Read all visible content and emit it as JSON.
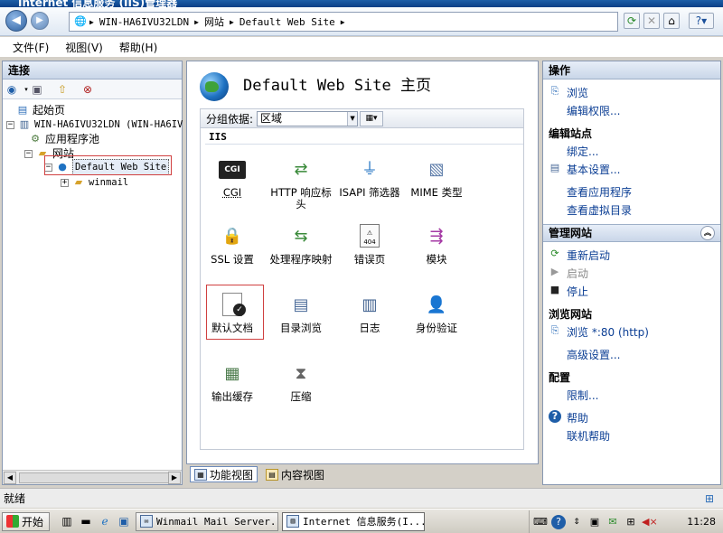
{
  "window": {
    "title": "Internet 信息服务 (IIS)管理器"
  },
  "address": {
    "segments": [
      "WIN-HA6IVU32LDN",
      "网站",
      "Default Web Site"
    ]
  },
  "menu": {
    "items": [
      "文件(F)",
      "视图(V)",
      "帮助(H)"
    ]
  },
  "connections": {
    "header": "连接",
    "tree": {
      "start": "起始页",
      "server": "WIN-HA6IVU32LDN (WIN-HA6IV",
      "app_pools": "应用程序池",
      "sites": "网站",
      "site": "Default Web Site",
      "child": "winmail"
    }
  },
  "center": {
    "title": "Default Web Site 主页",
    "group_label": "分组依据:",
    "group_value": "区域",
    "section": "IIS",
    "features": [
      {
        "label": "CGI",
        "icon": "cgi-icon"
      },
      {
        "label": "HTTP 响应标头",
        "icon": "http-response-headers-icon"
      },
      {
        "label": "ISAPI 筛选器",
        "icon": "isapi-filters-icon"
      },
      {
        "label": "MIME 类型",
        "icon": "mime-types-icon"
      },
      {
        "label": "SSL 设置",
        "icon": "ssl-lock-icon"
      },
      {
        "label": "处理程序映射",
        "icon": "handler-mappings-icon"
      },
      {
        "label": "错误页",
        "icon": "error-pages-icon"
      },
      {
        "label": "模块",
        "icon": "modules-icon"
      },
      {
        "label": "默认文档",
        "icon": "default-document-icon"
      },
      {
        "label": "目录浏览",
        "icon": "directory-browsing-icon"
      },
      {
        "label": "日志",
        "icon": "logging-icon"
      },
      {
        "label": "身份验证",
        "icon": "authentication-icon"
      },
      {
        "label": "输出缓存",
        "icon": "output-caching-icon"
      },
      {
        "label": "压缩",
        "icon": "compression-icon"
      }
    ]
  },
  "tabs": {
    "features_view": "功能视图",
    "content_view": "内容视图"
  },
  "actions": {
    "header": "操作",
    "browse": "浏览",
    "edit_permissions": "编辑权限...",
    "edit_site_title": "编辑站点",
    "bindings": "绑定...",
    "basic_settings": "基本设置...",
    "view_applications": "查看应用程序",
    "view_virtual_dirs": "查看虚拟目录",
    "manage_site_title": "管理网站",
    "restart": "重新启动",
    "start": "启动",
    "stop": "停止",
    "browse_site_title": "浏览网站",
    "browse_port": "浏览 *:80 (http)",
    "advanced_settings": "高级设置...",
    "config_title": "配置",
    "limits": "限制...",
    "help": "帮助",
    "online_help": "联机帮助"
  },
  "status": {
    "text": "就绪"
  },
  "taskbar": {
    "start": "开始",
    "tasks": [
      "Winmail Mail Server...",
      "Internet 信息服务(I..."
    ],
    "clock": "11:28"
  }
}
